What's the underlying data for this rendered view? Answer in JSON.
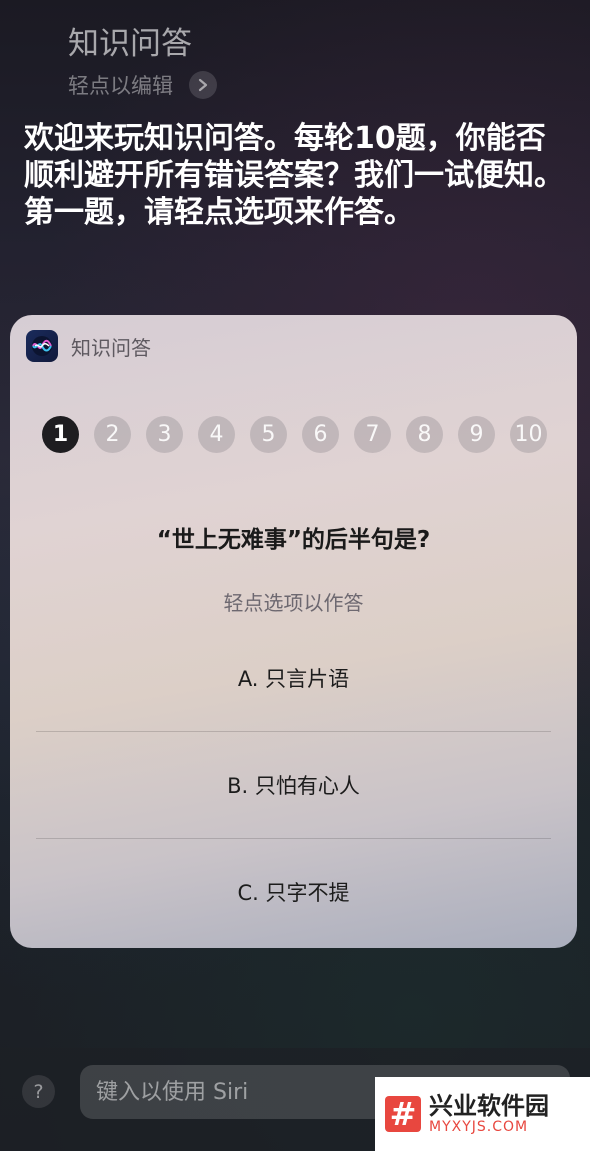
{
  "siri": {
    "query": "知识问答",
    "edit_hint": "轻点以编辑",
    "response": "欢迎来玩知识问答。每轮10题，你能否顺利避开所有错误答案？我们一试便知。第一题，请轻点选项来作答。"
  },
  "card": {
    "app_name": "知识问答",
    "app_icon": "siri-icon",
    "steps": [
      "1",
      "2",
      "3",
      "4",
      "5",
      "6",
      "7",
      "8",
      "9",
      "10"
    ],
    "current_step": 1,
    "question": "“世上无难事”的后半句是?",
    "instruction": "轻点选项以作答",
    "options": [
      "A. 只言片语",
      "B. 只怕有心人",
      "C. 只字不提"
    ]
  },
  "bottom": {
    "help_label": "?",
    "input_placeholder": "键入以使用 Siri"
  },
  "watermark": {
    "logo": "#",
    "name": "兴业软件园",
    "url": "MYXYJS.COM"
  },
  "colors": {
    "card_bg": "#dccfc7",
    "active_step": "#1e1d20",
    "watermark_accent": "#e8473f"
  }
}
